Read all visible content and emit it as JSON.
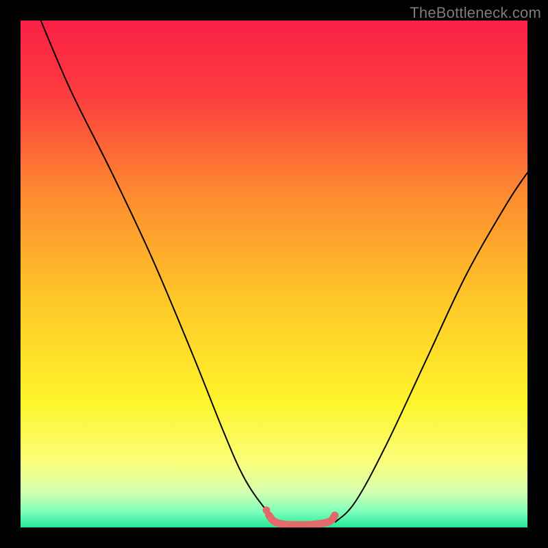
{
  "watermark": "TheBottleneck.com",
  "chart_data": {
    "type": "line",
    "title": "",
    "xlabel": "",
    "ylabel": "",
    "xlim": [
      0,
      100
    ],
    "ylim": [
      0,
      100
    ],
    "grid": false,
    "series": [
      {
        "name": "left-descent-curve",
        "color": "#000000",
        "x": [
          4,
          10,
          18,
          26,
          34,
          40,
          44,
          48,
          51
        ],
        "y": [
          100,
          86,
          70,
          53,
          34,
          19,
          10,
          4,
          1
        ]
      },
      {
        "name": "right-ascent-curve",
        "color": "#000000",
        "x": [
          62,
          66,
          72,
          80,
          88,
          96,
          100
        ],
        "y": [
          1,
          5,
          16,
          33,
          50,
          64,
          70
        ]
      },
      {
        "name": "bottom-highlight-segment",
        "color": "#e46a6a",
        "x": [
          49,
          50,
          52,
          55,
          58,
          61,
          62
        ],
        "y": [
          2.4,
          1.2,
          0.6,
          0.5,
          0.6,
          1.2,
          2.4
        ]
      }
    ],
    "points": [
      {
        "name": "left-highlight-dot",
        "x": 48.5,
        "y": 3.4,
        "color": "#e46a6a"
      }
    ],
    "annotations": [],
    "background": {
      "type": "vertical-gradient",
      "stops": [
        {
          "at": 0.0,
          "color": "#fb2046"
        },
        {
          "at": 0.15,
          "color": "#fc3d3e"
        },
        {
          "at": 0.35,
          "color": "#fd8d2f"
        },
        {
          "at": 0.55,
          "color": "#fec727"
        },
        {
          "at": 0.75,
          "color": "#fef32b"
        },
        {
          "at": 0.87,
          "color": "#faff78"
        },
        {
          "at": 0.93,
          "color": "#d4ffb0"
        },
        {
          "at": 0.97,
          "color": "#7affba"
        },
        {
          "at": 1.0,
          "color": "#25e89a"
        }
      ]
    }
  }
}
